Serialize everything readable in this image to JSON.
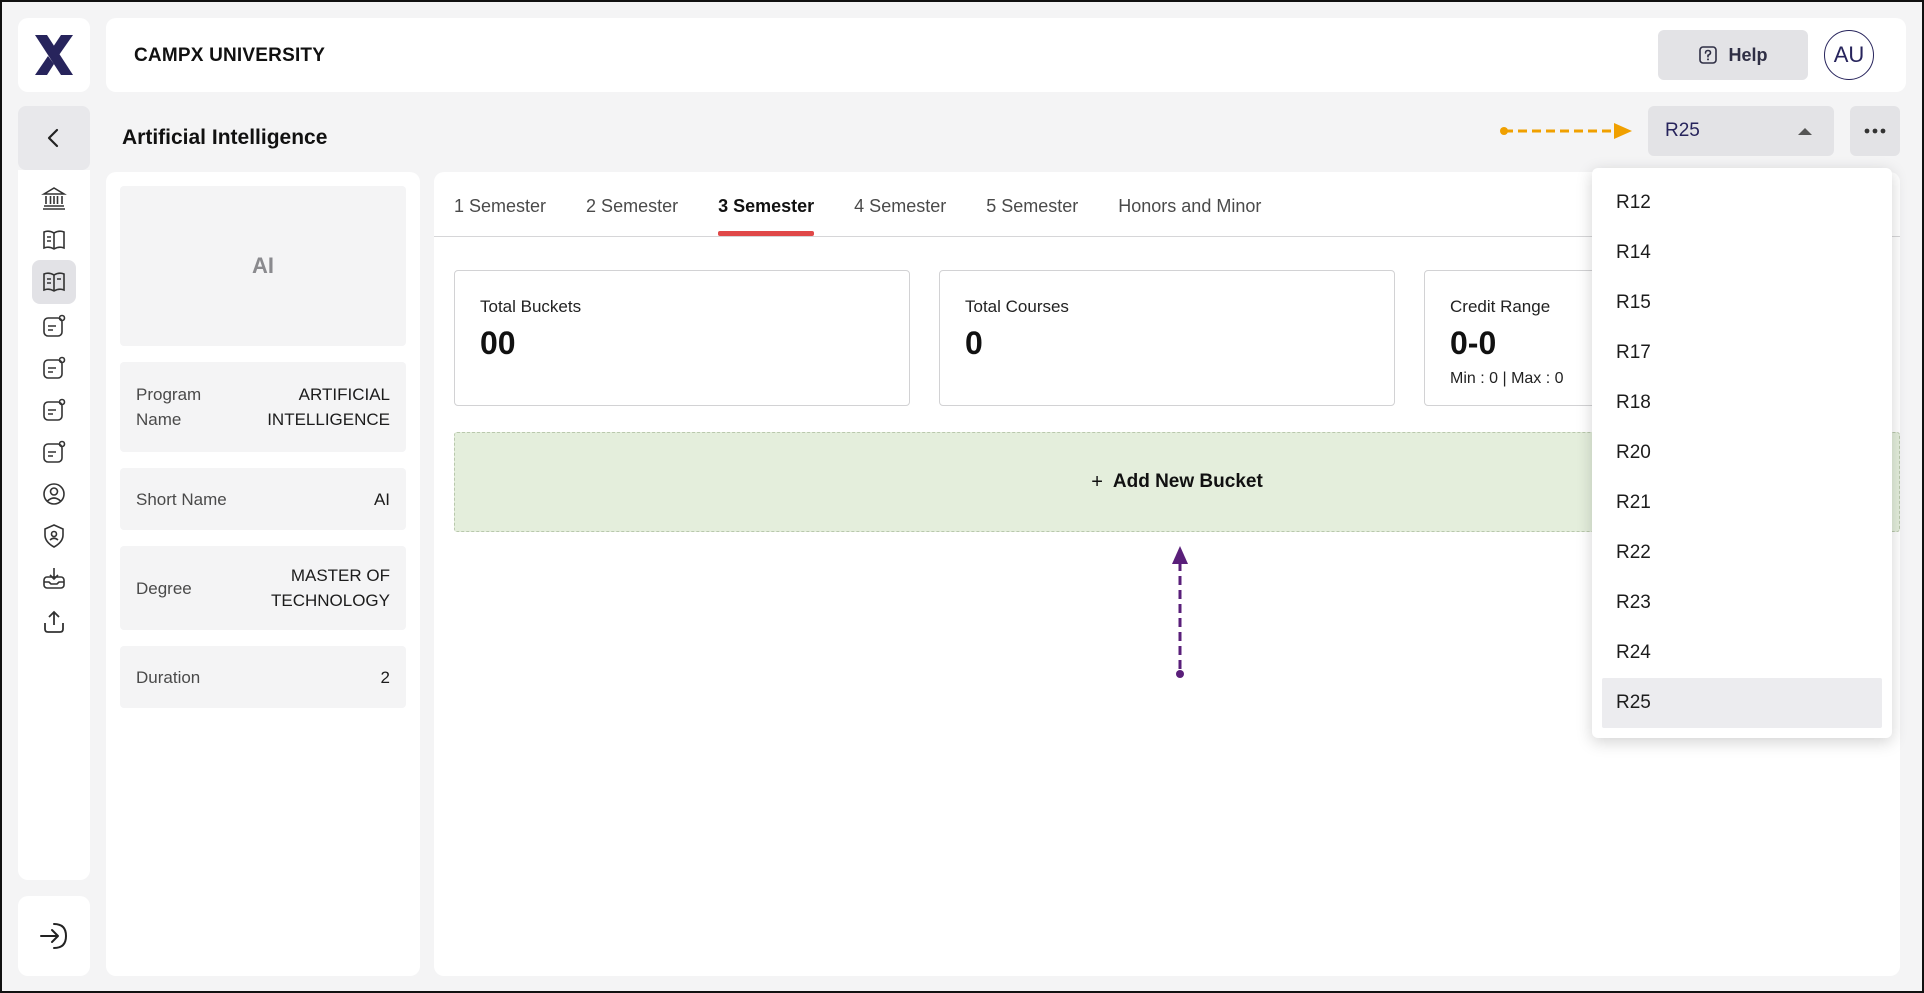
{
  "header": {
    "logo_icon": "campx-x-logo-icon",
    "university_name": "CAMPX UNIVERSITY",
    "help_label": "Help",
    "avatar_initials": "AU"
  },
  "page": {
    "title": "Artificial Intelligence",
    "regulation_selected": "R25"
  },
  "nav": {
    "icons": [
      "bank-icon",
      "book-icon",
      "book-open-icon",
      "badge-icon",
      "badge-icon",
      "badge-icon",
      "badge-icon",
      "user-circle-icon",
      "shield-user-icon",
      "download-tray-icon",
      "upload-icon"
    ],
    "active_index": 2
  },
  "program": {
    "tile_label": "AI",
    "rows": [
      {
        "label": "Program Name",
        "value": "ARTIFICIAL INTELLIGENCE"
      },
      {
        "label": "Short Name",
        "value": "AI"
      },
      {
        "label": "Degree",
        "value": "MASTER OF TECHNOLOGY"
      },
      {
        "label": "Duration",
        "value": "2"
      }
    ]
  },
  "tabs": [
    "1 Semester",
    "2 Semester",
    "3 Semester",
    "4 Semester",
    "5 Semester",
    "Honors and Minor"
  ],
  "active_tab": "3 Semester",
  "stats": {
    "total_buckets_label": "Total Buckets",
    "total_buckets_value": "00",
    "total_courses_label": "Total Courses",
    "total_courses_value": "0",
    "credit_range_label": "Credit Range",
    "credit_range_value": "0-0",
    "credit_range_sub": "Min : 0 | Max : 0"
  },
  "add_bucket": {
    "plus": "+",
    "label": "Add New Bucket"
  },
  "regulation_options": [
    "R12",
    "R14",
    "R15",
    "R17",
    "R18",
    "R20",
    "R21",
    "R22",
    "R23",
    "R24",
    "R25"
  ],
  "colors": {
    "brand_navy": "#27245c",
    "tab_accent": "#e04848",
    "add_bucket_bg": "#e4eedc",
    "annotation_orange": "#f0a000",
    "annotation_purple": "#5a1f7a"
  }
}
